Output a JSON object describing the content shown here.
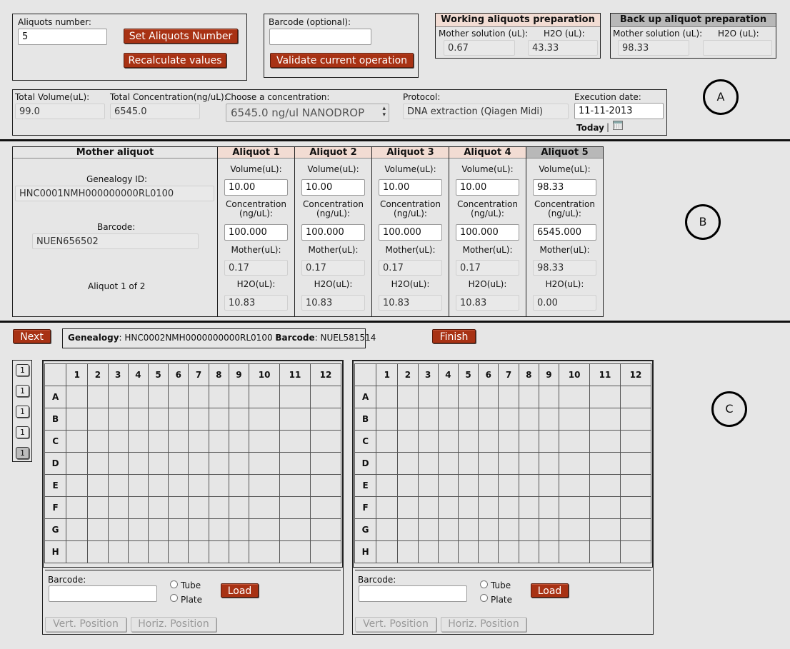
{
  "sectionA": {
    "aliquots_label": "Aliquots number:",
    "aliquots_value": "5",
    "set_button": "Set Aliquots Number",
    "recalc_button": "Recalculate values",
    "barcode_label": "Barcode (optional):",
    "barcode_value": "",
    "validate_button": "Validate current operation",
    "working": {
      "title": "Working aliquots preparation",
      "mother_label": "Mother solution (uL):",
      "h2o_label": "H2O (uL):",
      "mother_value": "0.67",
      "h2o_value": "43.33"
    },
    "backup": {
      "title": "Back up aliquot preparation",
      "mother_label": "Mother solution (uL):",
      "h2o_label": "H2O (uL):",
      "mother_value": "98.33",
      "h2o_value": ""
    },
    "total_volume_label": "Total Volume(uL):",
    "total_volume_value": "99.0",
    "total_conc_label": "Total Concentration(ng/uL):",
    "total_conc_value": "6545.0",
    "choose_conc_label": "Choose a concentration:",
    "choose_conc_value": "6545.0 ng/ul NANODROP",
    "protocol_label": "Protocol:",
    "protocol_value": "DNA extraction (Qiagen Midi)",
    "exec_date_label": "Execution date:",
    "exec_date_value": "11-11-2013",
    "today_label": "Today",
    "separator": "|",
    "marker": "A"
  },
  "sectionB": {
    "mother_header": "Mother aliquot",
    "genealogy_label": "Genealogy ID:",
    "genealogy_value": "HNC0001NMH000000000RL0100",
    "barcode_label": "Barcode:",
    "barcode_value": "NUEN656502",
    "aliquot_counter": "Aliquot 1 of 2",
    "volume_label": "Volume(uL):",
    "conc_label": "Concentration (ng/uL):",
    "mother_label": "Mother(uL):",
    "h2o_label": "H2O(uL):",
    "aliquots": [
      {
        "title": "Aliquot 1",
        "volume": "10.00",
        "conc": "100.000",
        "mother": "0.17",
        "h2o": "10.83"
      },
      {
        "title": "Aliquot 2",
        "volume": "10.00",
        "conc": "100.000",
        "mother": "0.17",
        "h2o": "10.83"
      },
      {
        "title": "Aliquot 3",
        "volume": "10.00",
        "conc": "100.000",
        "mother": "0.17",
        "h2o": "10.83"
      },
      {
        "title": "Aliquot 4",
        "volume": "10.00",
        "conc": "100.000",
        "mother": "0.17",
        "h2o": "10.83"
      },
      {
        "title": "Aliquot 5",
        "volume": "98.33",
        "conc": "6545.000",
        "mother": "98.33",
        "h2o": "0.00"
      }
    ],
    "colors": {
      "working_header": "#f2dcd3",
      "backup_header": "#b8b8b8"
    },
    "marker": "B"
  },
  "sectionC": {
    "next_button": "Next",
    "genealogy_key": "Genealogy",
    "genealogy_value": ": HNC0002NMH0000000000RL0100 ",
    "barcode_key": "Barcode",
    "barcode_value": ": NUEL581514",
    "finish_button": "Finish",
    "side_tabs": [
      "1",
      "1",
      "1",
      "1",
      "1"
    ],
    "columns": [
      "1",
      "2",
      "3",
      "4",
      "5",
      "6",
      "7",
      "8",
      "9",
      "10",
      "11",
      "12"
    ],
    "rows": [
      "A",
      "B",
      "C",
      "D",
      "E",
      "F",
      "G",
      "H"
    ],
    "plates": [
      {
        "barcode_label": "Barcode:",
        "barcode_value": "",
        "tube_label": "Tube",
        "plate_label": "Plate",
        "load_button": "Load",
        "vert_button": "Vert. Position",
        "horiz_button": "Horiz. Position"
      },
      {
        "barcode_label": "Barcode:",
        "barcode_value": "",
        "tube_label": "Tube",
        "plate_label": "Plate",
        "load_button": "Load",
        "vert_button": "Vert. Position",
        "horiz_button": "Horiz. Position"
      }
    ],
    "marker": "C"
  },
  "colors": {
    "accent": "#a83214",
    "background": "#e6e6e6"
  }
}
